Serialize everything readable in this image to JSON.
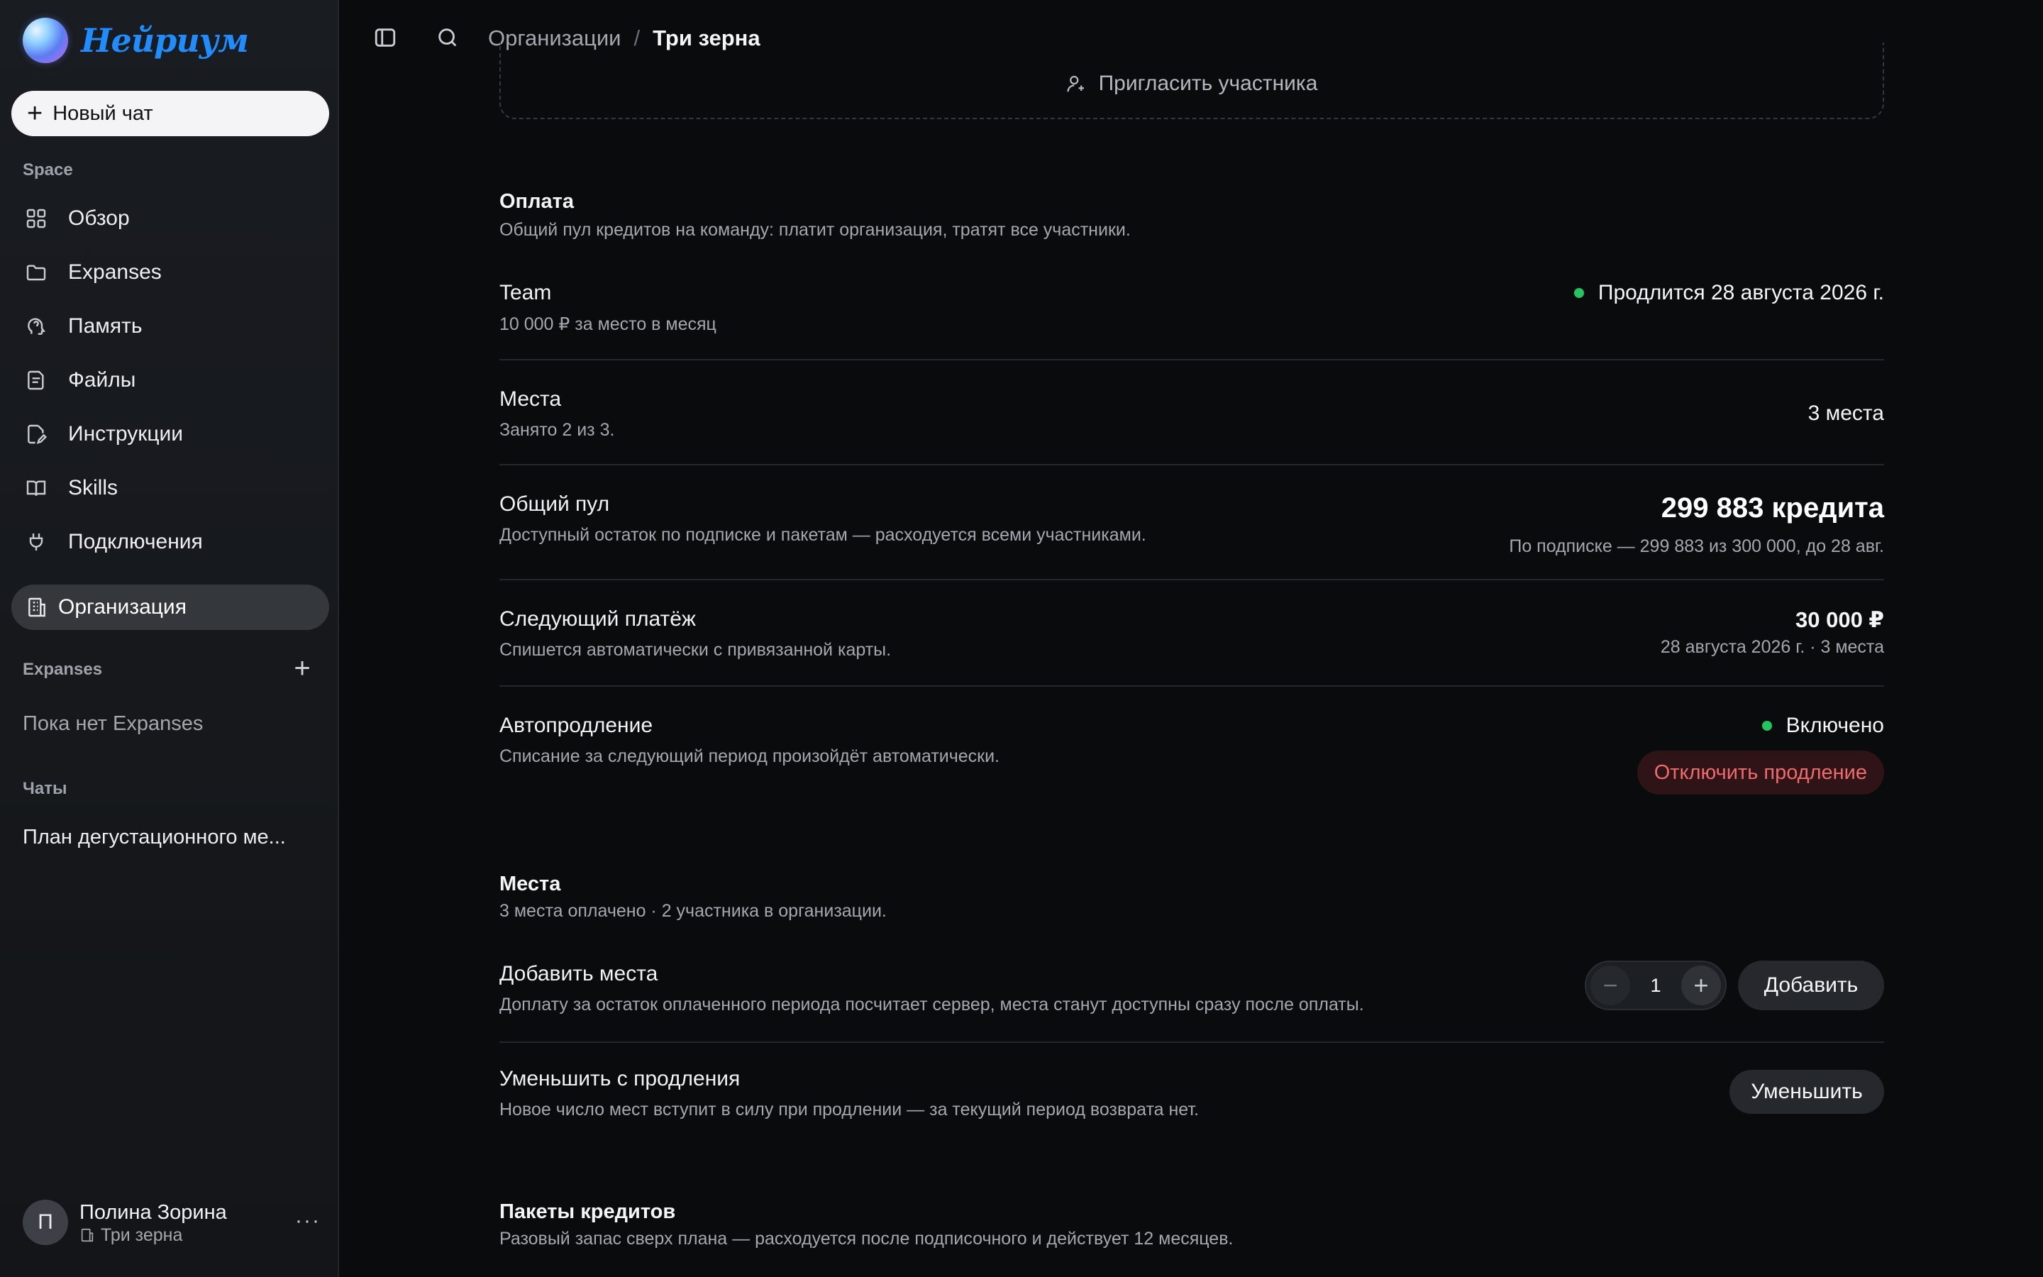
{
  "app": {
    "name": "Нейриум"
  },
  "sidebar": {
    "new_chat": "Новый чат",
    "space_label": "Space",
    "items": [
      {
        "label": "Обзор",
        "icon": "grid-icon"
      },
      {
        "label": "Expanses",
        "icon": "folder-icon"
      },
      {
        "label": "Память",
        "icon": "brain-icon"
      },
      {
        "label": "Файлы",
        "icon": "file-icon"
      },
      {
        "label": "Инструкции",
        "icon": "document-edit-icon"
      },
      {
        "label": "Skills",
        "icon": "book-icon"
      },
      {
        "label": "Подключения",
        "icon": "plug-icon"
      }
    ],
    "active": {
      "label": "Организация",
      "icon": "building-icon"
    },
    "expanses_label": "Expanses",
    "expanses_empty": "Пока нет Expanses",
    "chats_label": "Чаты",
    "chats": [
      "План дегустационного ме..."
    ],
    "user": {
      "initial": "П",
      "name": "Полина Зорина",
      "org": "Три зерна"
    }
  },
  "topbar": {
    "breadcrumb": [
      "Организации",
      "Три зерна"
    ],
    "separator": "/"
  },
  "main": {
    "invite_label": "Пригласить участника",
    "payment": {
      "title": "Оплата",
      "subtitle": "Общий пул кредитов на команду: платит организация, тратят все участники.",
      "plan": {
        "title": "Team",
        "sub": "10 000 ₽ за место в месяц",
        "status": "Продлится 28 августа 2026 г."
      },
      "seats": {
        "title": "Места",
        "sub": "Занято 2 из 3.",
        "value": "3 места"
      },
      "pool": {
        "title": "Общий пул",
        "sub": "Доступный остаток по подписке и пакетам — расходуется всеми участниками.",
        "value": "299 883 кредита",
        "note": "По подписке — 299 883 из 300 000, до 28 авг."
      },
      "next_payment": {
        "title": "Следующий платёж",
        "sub": "Спишется автоматически с привязанной карты.",
        "value": "30 000 ₽",
        "note": "28 августа 2026 г. · 3 места"
      },
      "autorenew": {
        "title": "Автопродление",
        "sub": "Списание за следующий период произойдёт автоматически.",
        "status": "Включено",
        "button": "Отключить продление"
      }
    },
    "seats_section": {
      "title": "Места",
      "subtitle": "3 места оплачено · 2 участника в организации.",
      "add": {
        "title": "Добавить места",
        "sub": "Доплату за остаток оплаченного периода посчитает сервер, места станут доступны сразу после оплаты.",
        "qty": "1",
        "button": "Добавить"
      },
      "reduce": {
        "title": "Уменьшить с продления",
        "sub": "Новое число мест вступит в силу при продлении — за текущий период возврата нет.",
        "button": "Уменьшить"
      }
    },
    "packages": {
      "title": "Пакеты кредитов",
      "subtitle": "Разовый запас сверх плана — расходуется после подписочного и действует 12 месяцев."
    }
  },
  "colors": {
    "accent": "#1f8cff",
    "success": "#22c55e",
    "danger": "#ef6b6b"
  }
}
